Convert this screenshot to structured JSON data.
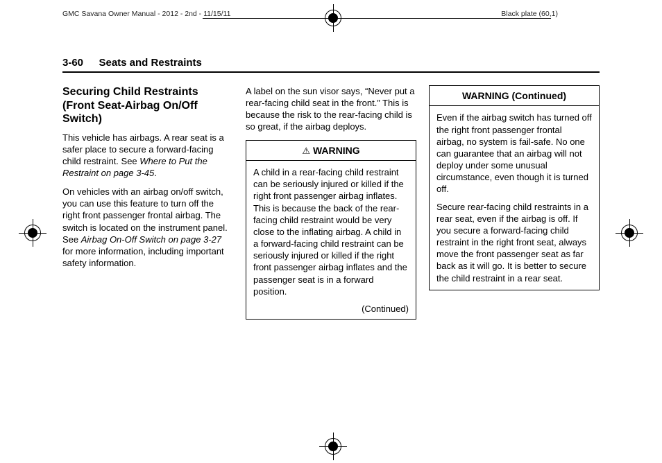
{
  "print": {
    "left": "GMC Savana Owner Manual - 2012 - 2nd - 11/15/11",
    "right": "Black plate (60,1)"
  },
  "header": {
    "page_num": "3-60",
    "section": "Seats and Restraints"
  },
  "col1": {
    "heading": "Securing Child Restraints (Front Seat-Airbag On/Off Switch)",
    "p1a": "This vehicle has airbags. A rear seat is a safer place to secure a forward-facing child restraint. See ",
    "p1_ref": "Where to Put the Restraint on page 3-45",
    "p1b": ".",
    "p2a": "On vehicles with an airbag on/off switch, you can use this feature to turn off the right front passenger frontal airbag. The switch is located on the instrument panel. See ",
    "p2_ref": "Airbag On-Off Switch on page 3-27",
    "p2b": " for more information, including important safety information."
  },
  "col2": {
    "p1": "A label on the sun visor says, “Never put a rear-facing child seat in the front.” This is because the risk to the rear-facing child is so great, if the airbag deploys.",
    "warn_label": "WARNING",
    "warn_body": "A child in a rear-facing child restraint can be seriously injured or killed if the right front passenger airbag inflates. This is because the back of the rear-facing child restraint would be very close to the inflating airbag. A child in a forward-facing child restraint can be seriously injured or killed if the right front passenger airbag inflates and the passenger seat is in a forward position.",
    "continued": "(Continued)"
  },
  "col3": {
    "warn_label": "WARNING  (Continued)",
    "warn_p1": "Even if the airbag switch has turned off the right front passenger frontal airbag, no system is fail-safe. No one can guarantee that an airbag will not deploy under some unusual circumstance, even though it is turned off.",
    "warn_p2": "Secure rear-facing child restraints in a rear seat, even if the airbag is off. If you secure a forward-facing child restraint in the right front seat, always move the front passenger seat as far back as it will go. It is better to secure the child restraint in a rear seat."
  }
}
